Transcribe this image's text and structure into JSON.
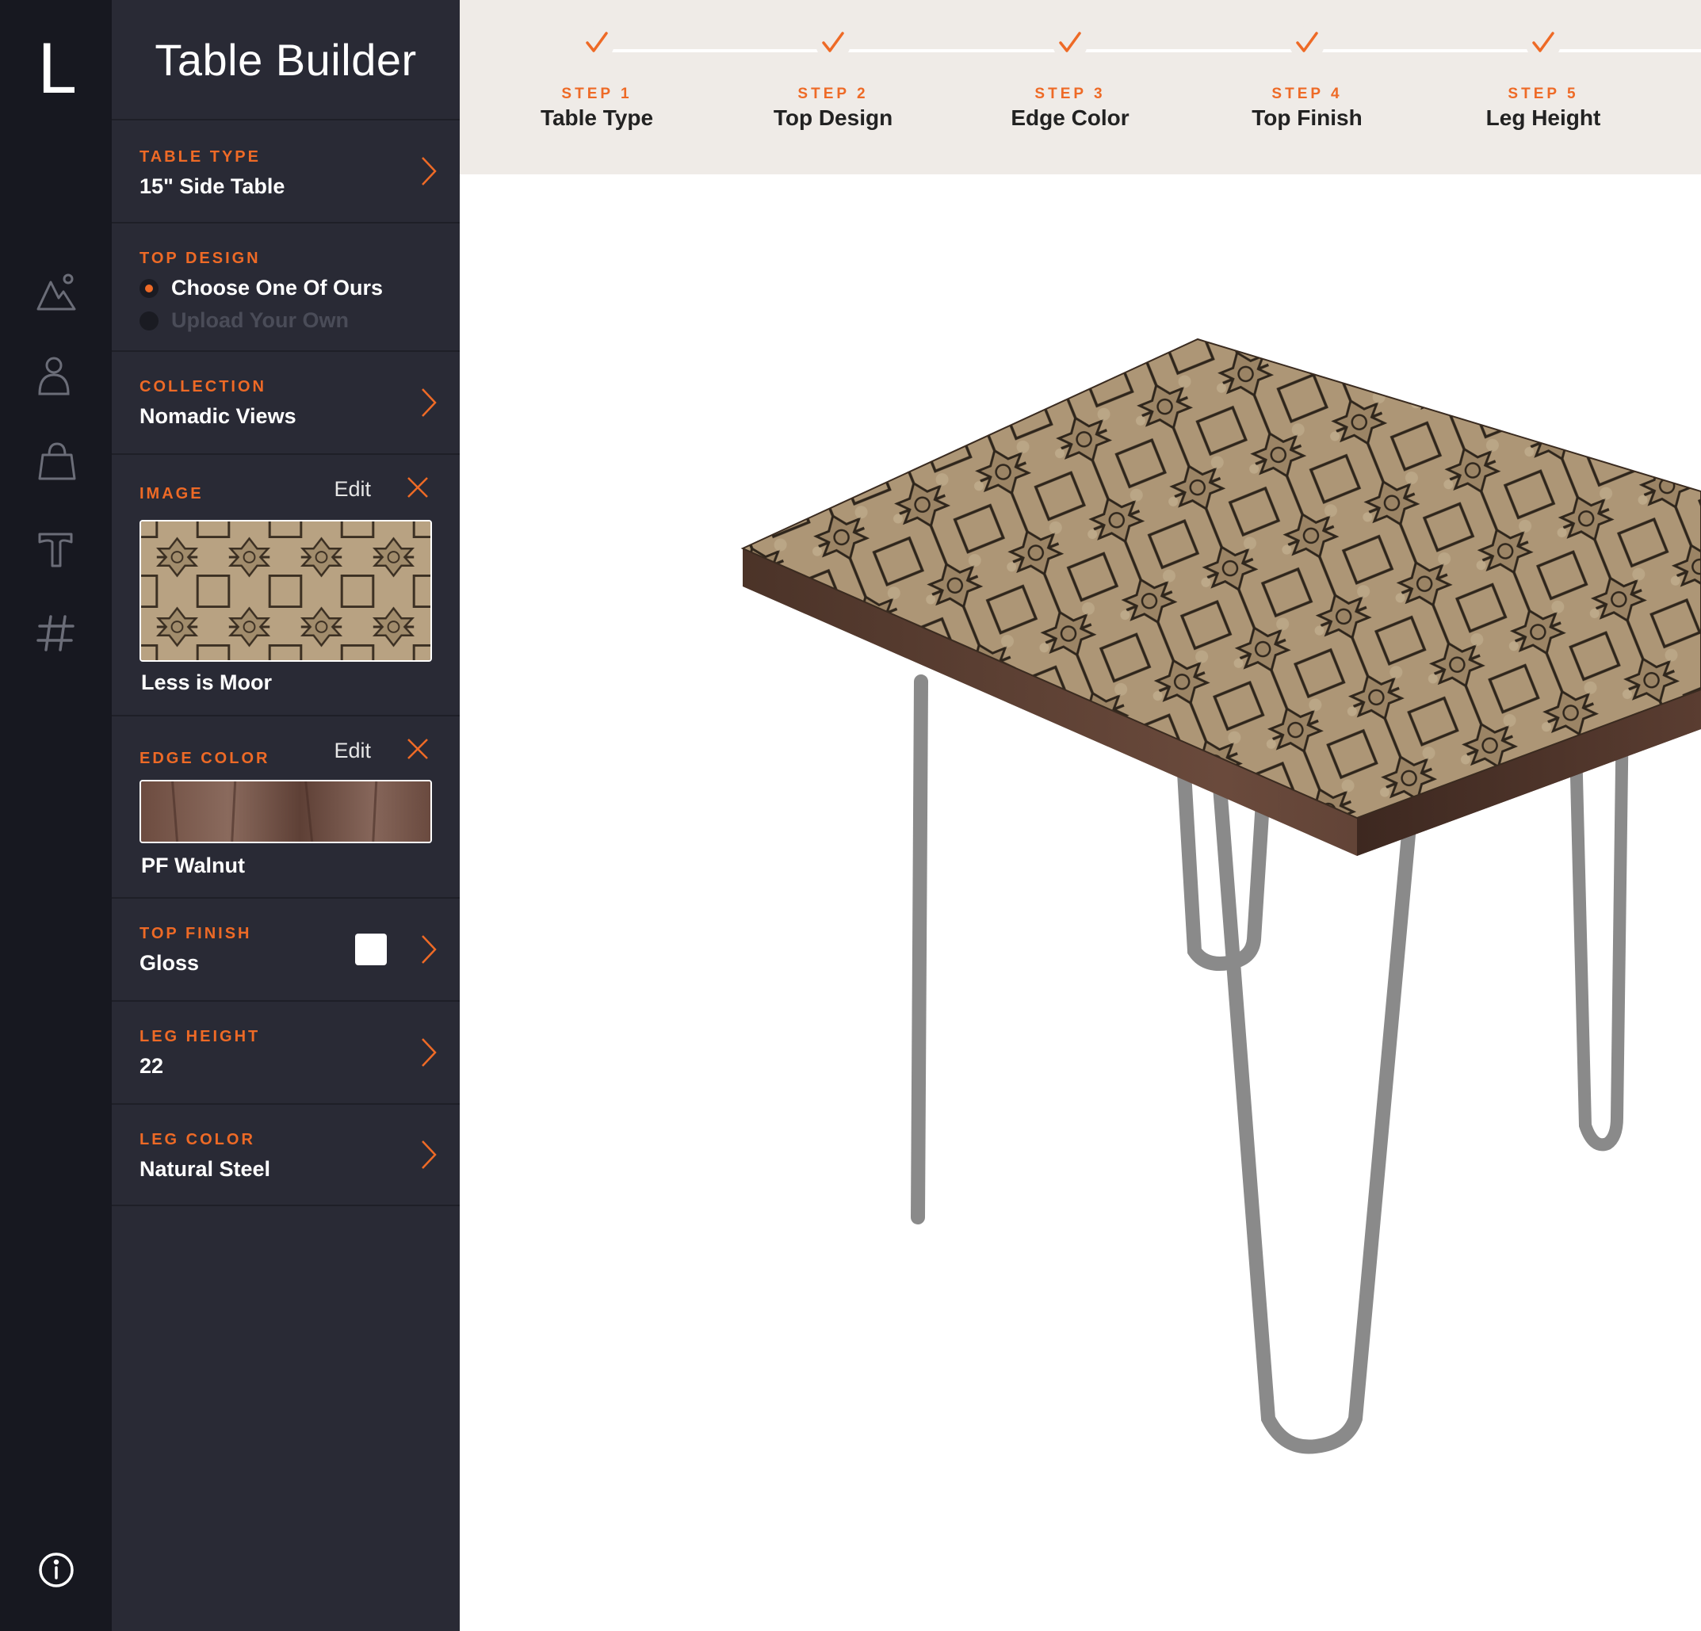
{
  "app": {
    "logo": "L",
    "title": "Table Builder"
  },
  "rail": {
    "icons": [
      "landscape-icon",
      "person-icon",
      "bag-icon",
      "text-icon",
      "hashtag-icon",
      "info-icon"
    ]
  },
  "sections": {
    "table_type": {
      "label": "TABLE TYPE",
      "value": "15\" Side Table"
    },
    "top_design": {
      "label": "TOP DESIGN",
      "options": [
        {
          "label": "Choose One Of Ours",
          "selected": true
        },
        {
          "label": "Upload Your Own",
          "selected": false
        }
      ]
    },
    "collection": {
      "label": "COLLECTION",
      "value": "Nomadic Views"
    },
    "image": {
      "label": "IMAGE",
      "edit": "Edit",
      "caption": "Less is Moor"
    },
    "edge_color": {
      "label": "EDGE COLOR",
      "edit": "Edit",
      "caption": "PF Walnut"
    },
    "top_finish": {
      "label": "TOP FINISH",
      "value": "Gloss"
    },
    "leg_height": {
      "label": "LEG HEIGHT",
      "value": "22"
    },
    "leg_color": {
      "label": "LEG COLOR",
      "value": "Natural Steel"
    }
  },
  "steps": [
    {
      "num": "STEP 1",
      "name": "Table Type",
      "done": true
    },
    {
      "num": "STEP 2",
      "name": "Top Design",
      "done": true
    },
    {
      "num": "STEP 3",
      "name": "Edge Color",
      "done": true
    },
    {
      "num": "STEP 4",
      "name": "Top Finish",
      "done": true
    },
    {
      "num": "STEP 5",
      "name": "Leg Height",
      "done": true
    }
  ],
  "colors": {
    "accent": "#ee6a26",
    "rail_bg": "#171820",
    "panel_bg": "#292a35",
    "steps_bg": "#efebe7"
  }
}
